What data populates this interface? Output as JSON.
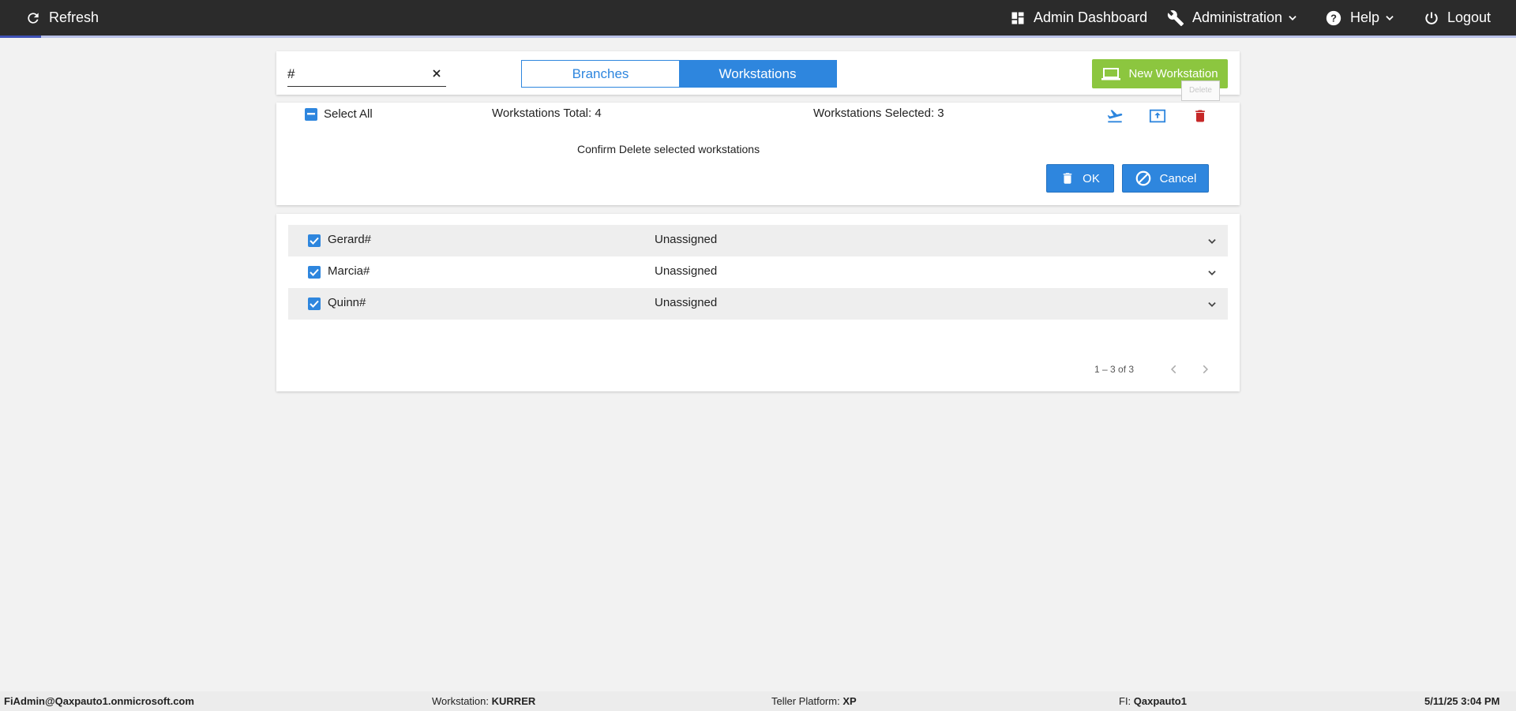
{
  "topbar": {
    "refresh_label": "Refresh",
    "admin_dashboard_label": "Admin Dashboard",
    "administration_label": "Administration",
    "help_label": "Help",
    "logout_label": "Logout",
    "background": "#2b2b2b"
  },
  "search": {
    "value": "#"
  },
  "tabs": [
    {
      "label": "Branches",
      "active": false
    },
    {
      "label": "Workstations",
      "active": true
    }
  ],
  "new_workstation_label": "New Workstation",
  "tooltip_text": "Delete",
  "summary": {
    "select_all_label": "Select All",
    "total_text": "Workstations Total: 4",
    "selected_text": "Workstations Selected: 3"
  },
  "confirm": {
    "message": "Confirm Delete selected workstations",
    "ok_label": "OK",
    "cancel_label": "Cancel"
  },
  "workstations": [
    {
      "name": "Gerard#",
      "status": "Unassigned",
      "checked": true
    },
    {
      "name": "Marcia#",
      "status": "Unassigned",
      "checked": true
    },
    {
      "name": "Quinn#",
      "status": "Unassigned",
      "checked": true
    }
  ],
  "pager": {
    "range_text": "1 – 3 of 3"
  },
  "footer": {
    "user": "FiAdmin@Qaxpauto1.onmicrosoft.com",
    "workstation_label": "Workstation:",
    "workstation_value": "KURRER",
    "platform_label": "Teller Platform:",
    "platform_value": "XP",
    "fi_label": "FI:",
    "fi_value": "Qaxpauto1",
    "datetime": "5/11/25 3:04 PM"
  },
  "colors": {
    "primary": "#2e86de",
    "success": "#8cc63f",
    "danger": "#c62828"
  },
  "icons": [
    "refresh-icon",
    "dashboard-icon",
    "wrench-icon",
    "help-icon",
    "power-icon",
    "laptop-icon",
    "close-icon",
    "airplane-icon",
    "upload-icon",
    "trash-icon",
    "cancel-icon",
    "chevron-down-icon",
    "chevron-left-icon",
    "chevron-right-icon"
  ]
}
